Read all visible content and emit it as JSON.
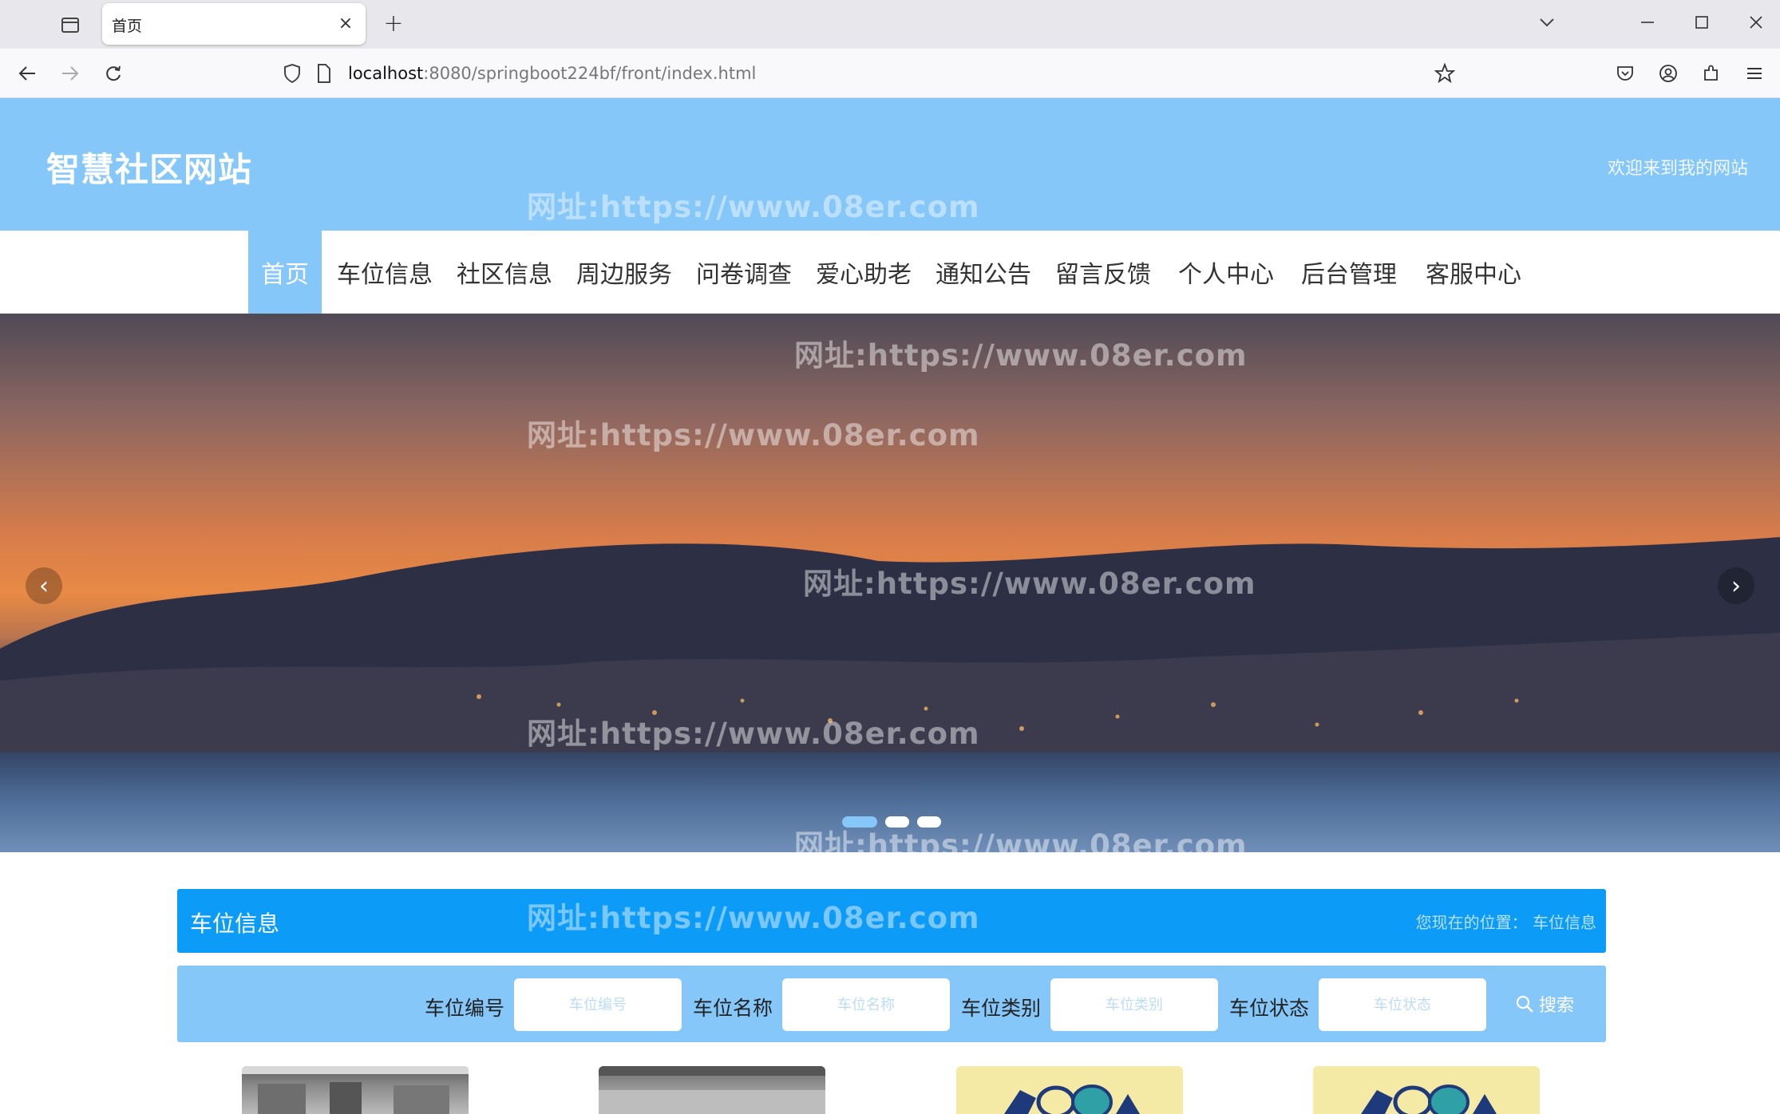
{
  "browser": {
    "tab_title": "首页",
    "url_host": "localhost",
    "url_rest": ":8080/springboot224bf/front/index.html"
  },
  "site": {
    "title": "智慧社区网站",
    "welcome": "欢迎来到我的网站"
  },
  "menu": [
    {
      "label": "首页",
      "active": true
    },
    {
      "label": "车位信息"
    },
    {
      "label": "社区信息"
    },
    {
      "label": "周边服务"
    },
    {
      "label": "问卷调查"
    },
    {
      "label": "爱心助老"
    },
    {
      "label": "通知公告"
    },
    {
      "label": "留言反馈"
    },
    {
      "label": "个人中心"
    },
    {
      "label": "后台管理"
    },
    {
      "label": "客服中心"
    }
  ],
  "banner": {
    "prev": "‹",
    "next": "›",
    "slides": 3,
    "active_slide": 1
  },
  "watermark": "网址:https://www.08er.com",
  "section": {
    "title": "车位信息",
    "breadcrumb": "您现在的位置： 车位信息"
  },
  "search": {
    "fields": [
      {
        "label": "车位编号",
        "placeholder": "车位编号"
      },
      {
        "label": "车位名称",
        "placeholder": "车位名称"
      },
      {
        "label": "车位类别",
        "placeholder": "车位类别"
      },
      {
        "label": "车位状态",
        "placeholder": "车位状态"
      }
    ],
    "button": "搜索"
  },
  "colors": {
    "header": "#85c7f8",
    "section_bar": "#0d9bf8"
  }
}
